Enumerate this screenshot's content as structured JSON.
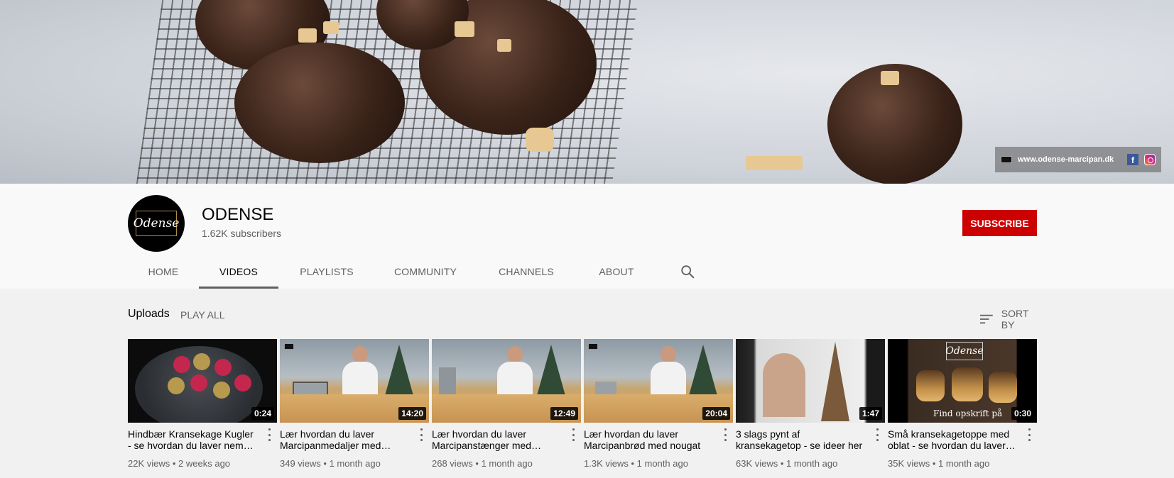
{
  "banner": {
    "website": "www.odense-marcipan.dk",
    "icons": [
      "facebook-icon",
      "instagram-icon"
    ]
  },
  "channel": {
    "logo_text": "Odense",
    "name": "ODENSE",
    "subscribers": "1.62K subscribers",
    "subscribe_label": "SUBSCRIBE",
    "accent_color": "#cc0000"
  },
  "tabs": [
    {
      "label": "HOME",
      "active": false
    },
    {
      "label": "VIDEOS",
      "active": true
    },
    {
      "label": "PLAYLISTS",
      "active": false
    },
    {
      "label": "COMMUNITY",
      "active": false
    },
    {
      "label": "CHANNELS",
      "active": false
    },
    {
      "label": "ABOUT",
      "active": false
    }
  ],
  "uploads": {
    "title": "Uploads",
    "play_all": "PLAY ALL",
    "sort_by": "SORT BY"
  },
  "videos": [
    {
      "title": "Hindbær Kransekage Kugler - se hvordan du laver nem…",
      "duration": "0:24",
      "views": "22K views",
      "age": "2 weeks ago"
    },
    {
      "title": "Lær hvordan du laver Marcipanmedaljer med…",
      "duration": "14:20",
      "views": "349 views",
      "age": "1 month ago"
    },
    {
      "title": "Lær hvordan du laver Marcipanstænger med…",
      "duration": "12:49",
      "views": "268 views",
      "age": "1 month ago"
    },
    {
      "title": "Lær hvordan du laver Marcipanbrød med nougat …",
      "duration": "20:04",
      "views": "1.3K views",
      "age": "1 month ago"
    },
    {
      "title": "3 slags pynt af kransekagetop - se ideer her",
      "duration": "1:47",
      "views": "63K views",
      "age": "1 month ago"
    },
    {
      "title": "Små kransekagetoppe med oblat - se hvordan du laver…",
      "duration": "0:30",
      "views": "35K views",
      "age": "1 month ago",
      "thumb_text": "Find opskrift på",
      "thumb_logo": "Odense"
    }
  ]
}
